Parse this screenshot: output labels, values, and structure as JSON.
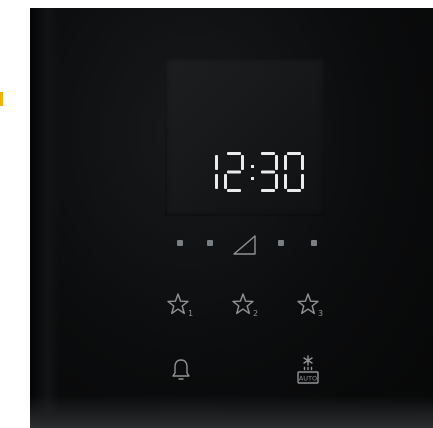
{
  "display": {
    "time": "12:30",
    "digit_color": "#e9ecec"
  },
  "power_level": {
    "indicators": 4,
    "icon": "power-ramp-icon"
  },
  "favourites": [
    {
      "number": "1",
      "icon": "star-icon"
    },
    {
      "number": "2",
      "icon": "star-icon"
    },
    {
      "number": "3",
      "icon": "star-icon"
    }
  ],
  "controls": {
    "timer_icon": "bell-icon",
    "defrost_icon": "auto-defrost-icon",
    "defrost_label": "AUTO"
  },
  "colors": {
    "panel": "#0b0c0d",
    "accent": "#f0b400",
    "icon_grey": "#8f9498"
  }
}
